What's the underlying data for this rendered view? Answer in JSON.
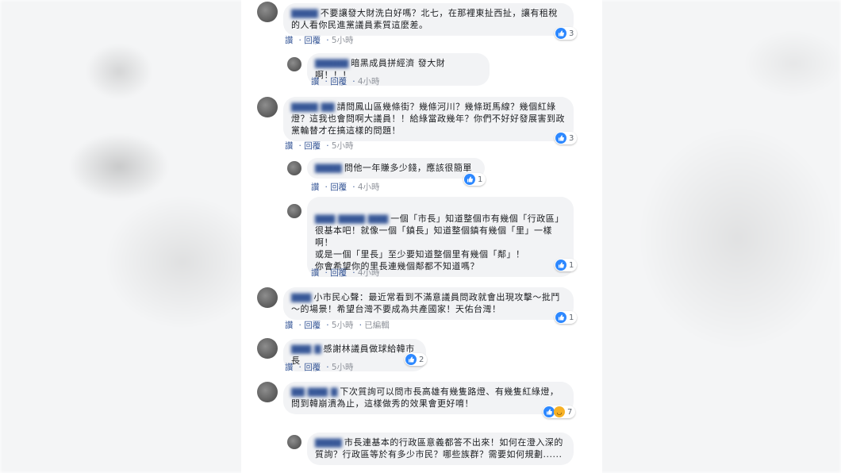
{
  "actions": {
    "like": "讚",
    "reply": "回覆",
    "edited": "已編輯"
  },
  "comments": [
    {
      "name": "▇▇▇▇",
      "text": "不要讓發大財洗白好嗎？北七，在那裡東扯西扯，讓有租稅的人看你民進黨議員素質這麼差。",
      "time": "5小時",
      "reactions": "3"
    },
    {
      "name": "▇▇▇▇▇",
      "text": "暗黑成員拼經濟 發大財啊！！！",
      "time": "4小時",
      "reactions": ""
    },
    {
      "name": "▇▇▇▇ ▇▇",
      "text": "請問鳳山區幾條街？幾條河川？幾條斑馬線？幾個紅綠燈？這我也會問啊大議員！！給綠當政幾年？你們不好好發展害到政黨輪替才在搞這樣的問題！",
      "time": "5小時",
      "reactions": "3"
    },
    {
      "name": "▇▇▇▇",
      "text": "問他一年賺多少錢，應該很簡單",
      "time": "4小時",
      "reactions": "1"
    },
    {
      "name": "▇▇▇ ▇▇▇▇ ▇▇▇",
      "text": "一個「市長」知道整個市有幾個「行政區」很基本吧！就像一個「鎮長」知道整個鎮有幾個「里」一樣啊！\n或是一個「里長」至少要知道整個里有幾個「鄰」！\n你會希望你的里長連幾個鄰都不知道嗎？",
      "time": "4小時",
      "reactions": "1"
    },
    {
      "name": "▇▇▇",
      "text": "小市民心聲：最近常看到不滿意議員問政就會出現攻擊～批鬥～的場景！希望台灣不要成為共產國家！天佑台灣！",
      "time": "5小時",
      "reactions": "1"
    },
    {
      "name": "▇▇▇ ▇",
      "text": "感謝林議員做球給韓市長",
      "time": "5小時",
      "reactions": "2"
    },
    {
      "name": "▇▇ ▇▇▇ ▇",
      "text": "下次質詢可以問市長高雄有幾隻路燈、有幾隻紅綠燈，問到韓崩潰為止，這樣做秀的效果會更好唷！",
      "time": "",
      "reactions": "7"
    },
    {
      "name": "▇▇▇▇",
      "text": "市長連基本的行政區意義都答不出來！如何在澄入深的質詢？行政區等於有多少市民？哪些族群？需要如何規劃......",
      "time": "",
      "reactions": ""
    }
  ]
}
